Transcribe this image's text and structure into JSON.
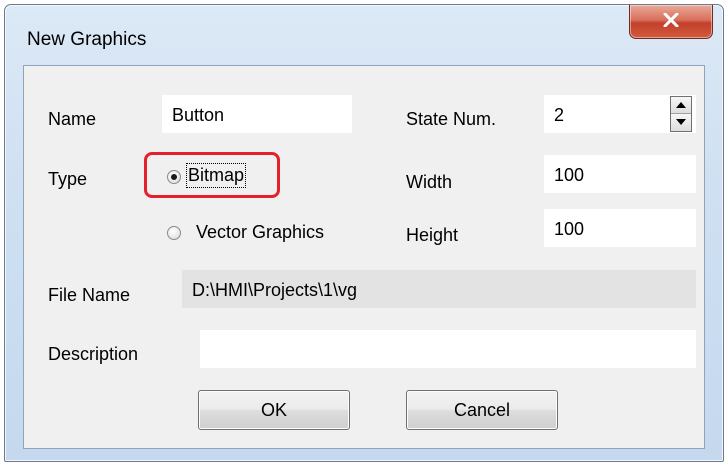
{
  "window": {
    "title": "New Graphics",
    "close_icon": "close-x-icon",
    "close_color": "#c7432e"
  },
  "form": {
    "name_label": "Name",
    "name_value": "Button",
    "type_label": "Type",
    "type_options": [
      {
        "label": "Bitmap",
        "selected": true
      },
      {
        "label": "Vector Graphics",
        "selected": false
      }
    ],
    "state_num_label": "State Num.",
    "state_num_value": "2",
    "width_label": "Width",
    "width_value": "100",
    "height_label": "Height",
    "height_value": "100",
    "file_name_label": "File Name",
    "file_name_value": "D:\\HMI\\Projects\\1\\vg",
    "description_label": "Description",
    "description_value": ""
  },
  "buttons": {
    "ok_label": "OK",
    "cancel_label": "Cancel"
  },
  "colors": {
    "highlight_border": "#e5202d",
    "title_bar": "#cfe0f2",
    "client_background": "#f0f0f0"
  }
}
